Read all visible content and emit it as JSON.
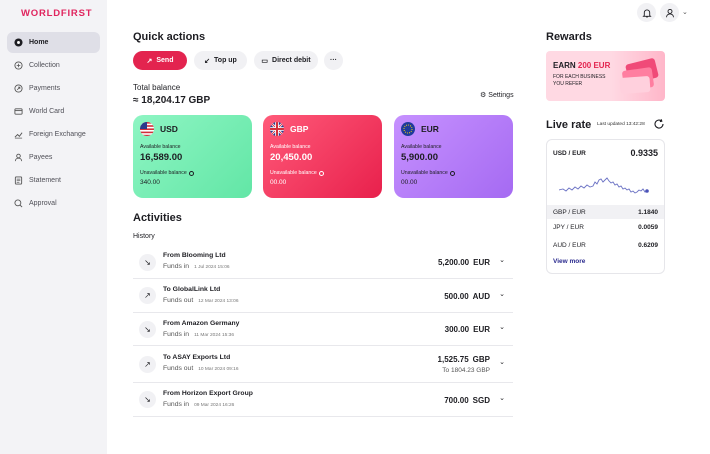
{
  "brand": {
    "logo": "WORLDFIRST",
    "accent": "#e3244f"
  },
  "sidebar": {
    "items": [
      {
        "label": "Home",
        "icon": "home-icon",
        "active": true
      },
      {
        "label": "Collection",
        "icon": "collection-icon"
      },
      {
        "label": "Payments",
        "icon": "payments-icon"
      },
      {
        "label": "World Card",
        "icon": "card-icon"
      },
      {
        "label": "Foreign Exchange",
        "icon": "exchange-icon"
      },
      {
        "label": "Payees",
        "icon": "payees-icon"
      },
      {
        "label": "Statement",
        "icon": "statement-icon"
      },
      {
        "label": "Approval",
        "icon": "approval-icon"
      }
    ]
  },
  "quick_actions": {
    "title": "Quick actions",
    "send": "Send",
    "top_up": "Top up",
    "direct_debit": "Direct debit",
    "more": "···"
  },
  "balance": {
    "label": "Total balance",
    "value": "≈ 18,204.17 GBP",
    "settings": "Settings"
  },
  "cards": [
    {
      "currency": "USD",
      "available_label": "Available balance",
      "available": "16,589.00",
      "unavailable_label": "Unavailable balance",
      "unavailable": "340.00"
    },
    {
      "currency": "GBP",
      "available_label": "Available balance",
      "available": "20,450.00",
      "unavailable_label": "Unavailable balance",
      "unavailable": "00.00"
    },
    {
      "currency": "EUR",
      "available_label": "Available balance",
      "available": "5,900.00",
      "unavailable_label": "Unavailable balance",
      "unavailable": "00.00"
    }
  ],
  "activities": {
    "title": "Activities",
    "history_label": "History",
    "rows": [
      {
        "title": "From Blooming Ltd",
        "type": "Funds in",
        "date": "1 Jul 2024 15:06",
        "amount": "5,200.00",
        "currency": "EUR",
        "direction": "in"
      },
      {
        "title": "To GlobalLink Ltd",
        "type": "Funds out",
        "date": "12 Mar 2024 13:06",
        "amount": "500.00",
        "currency": "AUD",
        "direction": "out"
      },
      {
        "title": "From Amazon Germany",
        "type": "Funds in",
        "date": "11 Mar 2024 15:36",
        "amount": "300.00",
        "currency": "EUR",
        "direction": "in"
      },
      {
        "title": "To ASAY Exports Ltd",
        "type": "Funds out",
        "date": "10 Mar 2024 09:16",
        "amount": "1,525.75",
        "currency": "GBP",
        "secondary": "To 1804.23 GBP",
        "direction": "out"
      },
      {
        "title": "From Horizon Export Group",
        "type": "Funds in",
        "date": "09 Mar 2024 16:26",
        "amount": "700.00",
        "currency": "SGD",
        "direction": "in"
      }
    ]
  },
  "rewards": {
    "title": "Rewards",
    "headline_prefix": "EARN ",
    "headline_amount": "200 EUR",
    "subtext": "FOR EACH BUSINESS YOU REFER"
  },
  "live_rate": {
    "title": "Live rate",
    "updated": "Last updated 13:42:28",
    "pair": "USD / EUR",
    "rate": "0.9335",
    "rows": [
      {
        "pair": "GBP / EUR",
        "value": "1.1840",
        "selected": true
      },
      {
        "pair": "JPY / EUR",
        "value": "0.0059"
      },
      {
        "pair": "AUD / EUR",
        "value": "0.6209"
      }
    ],
    "view_more": "View more"
  }
}
